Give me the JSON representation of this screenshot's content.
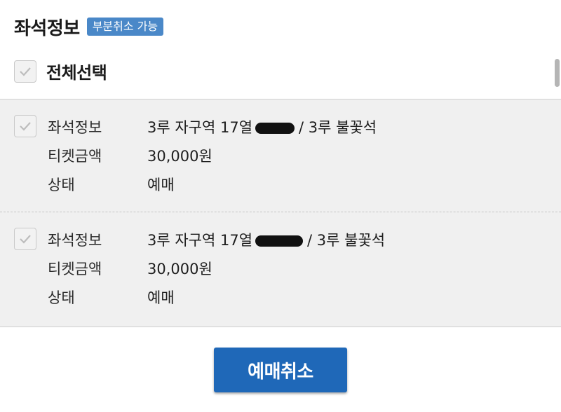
{
  "header": {
    "title": "좌석정보",
    "badge": "부분취소 가능"
  },
  "select_all": {
    "label": "전체선택",
    "checked": true
  },
  "icons": {
    "checkbox": "check-icon"
  },
  "colors": {
    "badge": "#4a88c8",
    "button": "#1f68b8",
    "panel": "#f0f0f0"
  },
  "tickets": [
    {
      "seat_label": "좌석정보",
      "seat_prefix": "3루 자구역 17열",
      "seat_suffix": "/ 3루 불꽃석",
      "price_label": "티켓금액",
      "price": "30,000원",
      "status_label": "상태",
      "status": "예매"
    },
    {
      "seat_label": "좌석정보",
      "seat_prefix": "3루 자구역 17열",
      "seat_suffix": "/ 3루 불꽃석",
      "price_label": "티켓금액",
      "price": "30,000원",
      "status_label": "상태",
      "status": "예매"
    }
  ],
  "cancel_button": {
    "label": "예매취소"
  }
}
